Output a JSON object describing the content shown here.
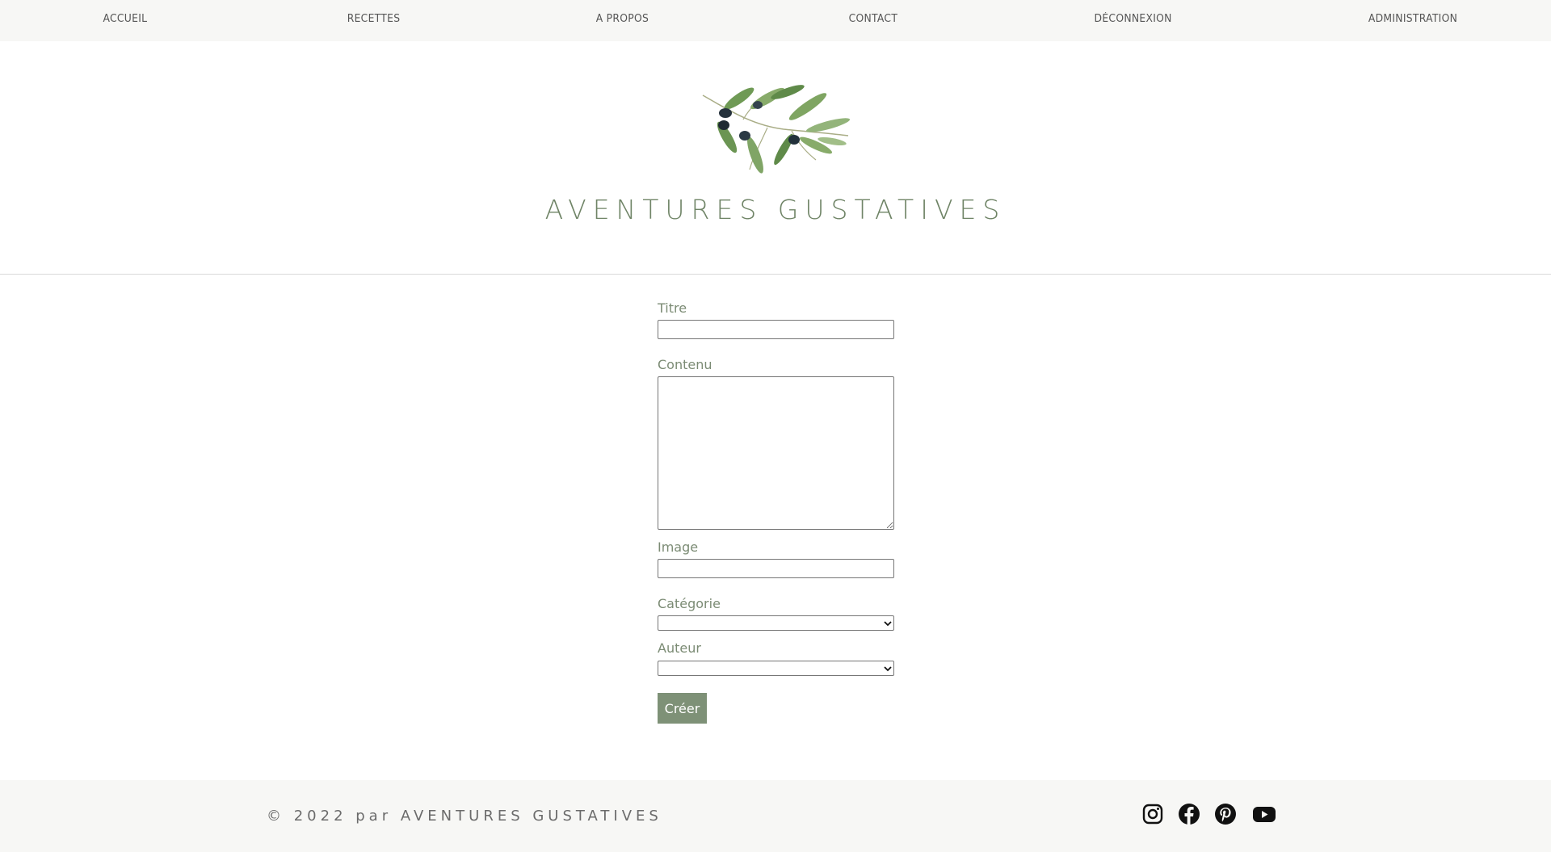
{
  "nav": {
    "items": [
      {
        "label": "ACCUEIL"
      },
      {
        "label": "RECETTES"
      },
      {
        "label": "A PROPOS"
      },
      {
        "label": "CONTACT"
      },
      {
        "label": "DÉCONNEXION"
      },
      {
        "label": "ADMINISTRATION"
      }
    ]
  },
  "header": {
    "logo_icon": "olive-branch-icon",
    "title": "AVENTURES GUSTATIVES"
  },
  "form": {
    "titre_label": "Titre",
    "titre_value": "",
    "contenu_label": "Contenu",
    "contenu_value": "",
    "image_label": "Image",
    "image_value": "",
    "categorie_label": "Catégorie",
    "categorie_value": "",
    "auteur_label": "Auteur",
    "auteur_value": "",
    "submit_label": "Créer"
  },
  "footer": {
    "copyright": "© 2022 par AVENTURES GUSTATIVES",
    "social": [
      "instagram-icon",
      "facebook-icon",
      "pinterest-icon",
      "youtube-icon"
    ]
  },
  "colors": {
    "accent": "#7e9177",
    "title": "#6f8466",
    "nav_bg": "#f7f7f5"
  }
}
